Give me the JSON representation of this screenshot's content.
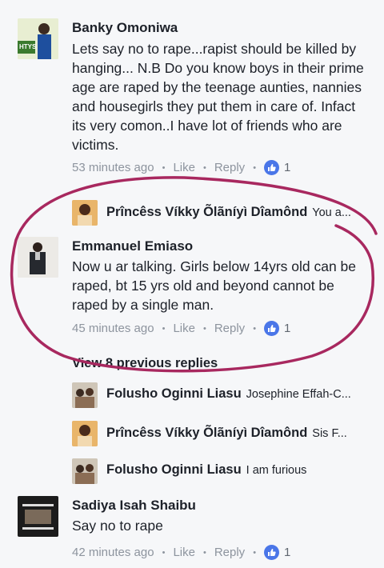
{
  "comments": {
    "banky": {
      "name": "Banky Omoniwa",
      "text": "Lets say no to rape...rapist should be killed by hanging... N.B Do you know boys in their prime age are raped by the teenage aunties, nannies and housegirls they put them in care of. Infact its very comon..I have lot of friends who are victims.",
      "time": "53 minutes ago",
      "like": "Like",
      "reply": "Reply",
      "likes": "1",
      "avatar_text": "HTYS"
    },
    "reply_vikky_1": {
      "name": "Prîncêss Víkky Õlãníyì Dîamônd",
      "text": "You a..."
    },
    "emmanuel": {
      "name": "Emmanuel Emiaso",
      "text": "Now u ar talking. Girls below 14yrs old can be raped, bt 15 yrs old and beyond cannot be raped by a single man.",
      "time": "45 minutes ago",
      "like": "Like",
      "reply": "Reply",
      "likes": "1"
    },
    "view_previous": "View 8 previous replies",
    "replies": [
      {
        "name": "Folusho Oginni Liasu",
        "text": "Josephine Effah-C..."
      },
      {
        "name": "Prîncêss Víkky Õlãníyì Dîamônd",
        "text": "Sis F..."
      },
      {
        "name": "Folusho Oginni Liasu",
        "text": "I am furious"
      }
    ],
    "sadiya": {
      "name": "Sadiya Isah Shaibu",
      "text": "Say no to rape",
      "time": "42 minutes ago",
      "like": "Like",
      "reply": "Reply",
      "likes": "1"
    }
  },
  "colors": {
    "background": "#f6f7f9",
    "like_badge": "#4a76e8",
    "circle_annotation": "#a8285f",
    "meta_text": "#8d949e"
  }
}
